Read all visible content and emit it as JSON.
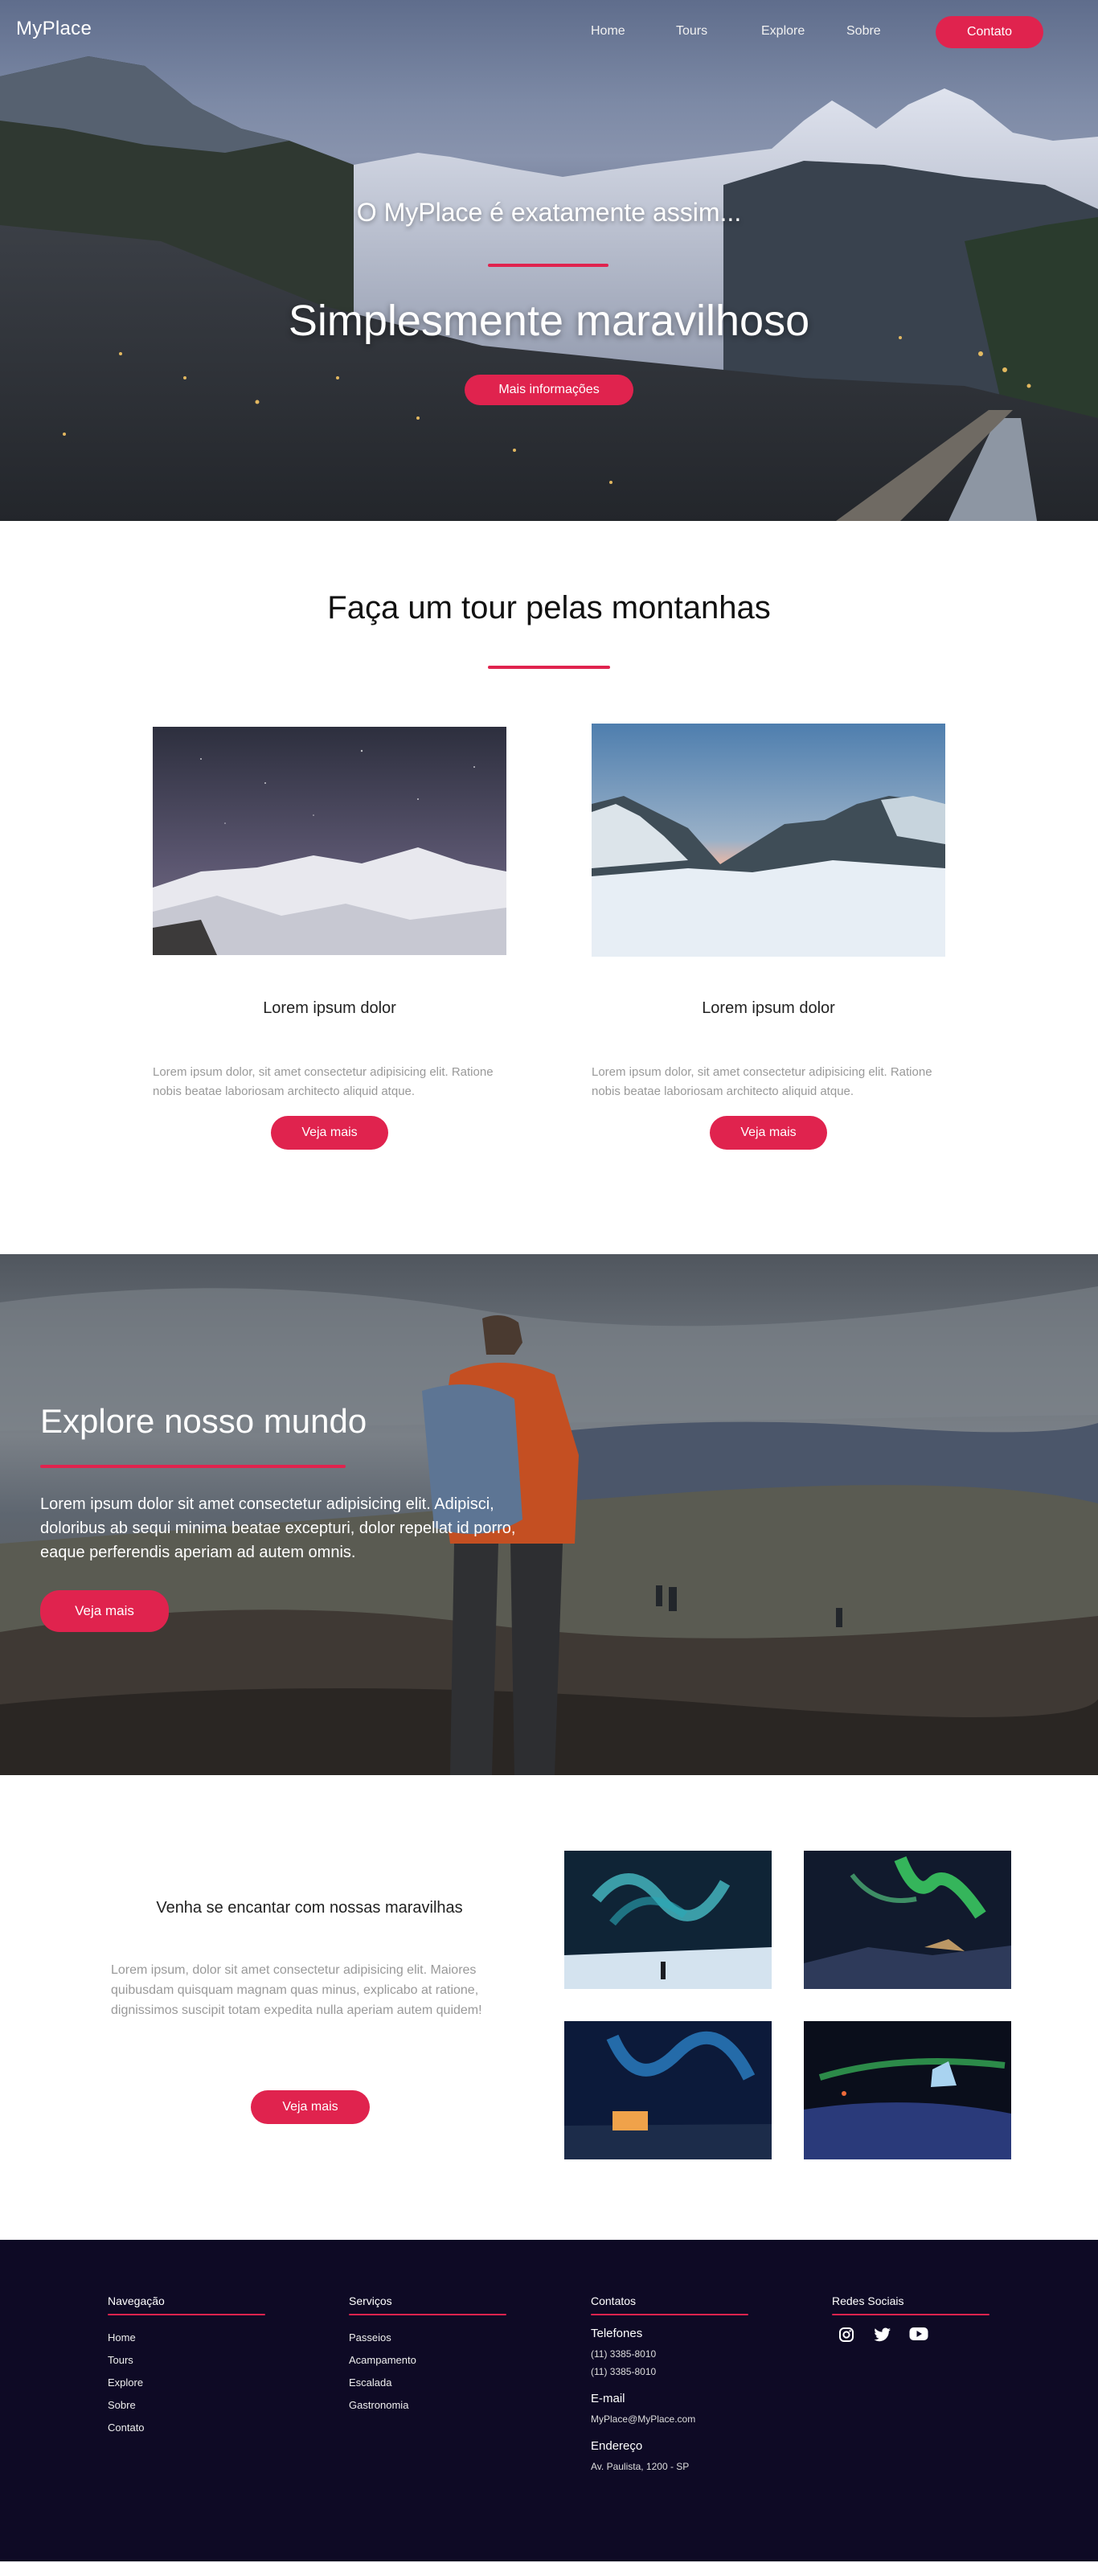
{
  "brand": "MyPlace",
  "nav": {
    "links": [
      "Home",
      "Tours",
      "Explore",
      "Sobre"
    ],
    "contact": "Contato"
  },
  "hero": {
    "subtitle": "O MyPlace é exatamente assim...",
    "title": "Simplesmente maravilhoso",
    "button": "Mais informações"
  },
  "tour": {
    "title": "Faça um tour pelas montanhas",
    "cards": [
      {
        "title": "Lorem ipsum dolor",
        "text": "Lorem ipsum dolor, sit amet consectetur adipisicing elit. Ratione nobis beatae laboriosam architecto aliquid atque.",
        "button": "Veja mais"
      },
      {
        "title": "Lorem ipsum dolor",
        "text": "Lorem ipsum dolor, sit amet consectetur adipisicing elit. Ratione nobis beatae laboriosam architecto aliquid atque.",
        "button": "Veja mais"
      }
    ]
  },
  "explore": {
    "title": "Explore nosso mundo",
    "text": "Lorem ipsum dolor sit amet consectetur adipisicing elit. Adipisci, doloribus ab sequi minima beatae excepturi, dolor repellat id porro, eaque perferendis aperiam ad autem omnis.",
    "button": "Veja mais"
  },
  "aurora": {
    "title": "Venha se encantar com nossas maravilhas",
    "text": "Lorem ipsum, dolor sit amet consectetur adipisicing elit. Maiores quibusdam quisquam magnam quas minus, explicabo at ratione, dignissimos suscipit totam expedita nulla aperiam autem quidem!",
    "button": "Veja mais"
  },
  "footer": {
    "navegacao": {
      "title": "Navegação",
      "items": [
        "Home",
        "Tours",
        "Explore",
        "Sobre",
        "Contato"
      ]
    },
    "servicos": {
      "title": "Serviços",
      "items": [
        "Passeios",
        "Acampamento",
        "Escalada",
        "Gastronomia"
      ]
    },
    "contatos": {
      "title": "Contatos",
      "phones_label": "Telefones",
      "phones": [
        "(11) 3385-8010",
        "(11) 3385-8010"
      ],
      "email_label": "E-mail",
      "email": "MyPlace@MyPlace.com",
      "address_label": "Endereço",
      "address": "Av. Paulista, 1200 - SP"
    },
    "social": {
      "title": "Redes Sociais",
      "icons": [
        "instagram-icon",
        "twitter-icon",
        "youtube-icon"
      ]
    }
  },
  "colors": {
    "accent": "#e0234e",
    "footer_bg": "#0e0a25"
  }
}
